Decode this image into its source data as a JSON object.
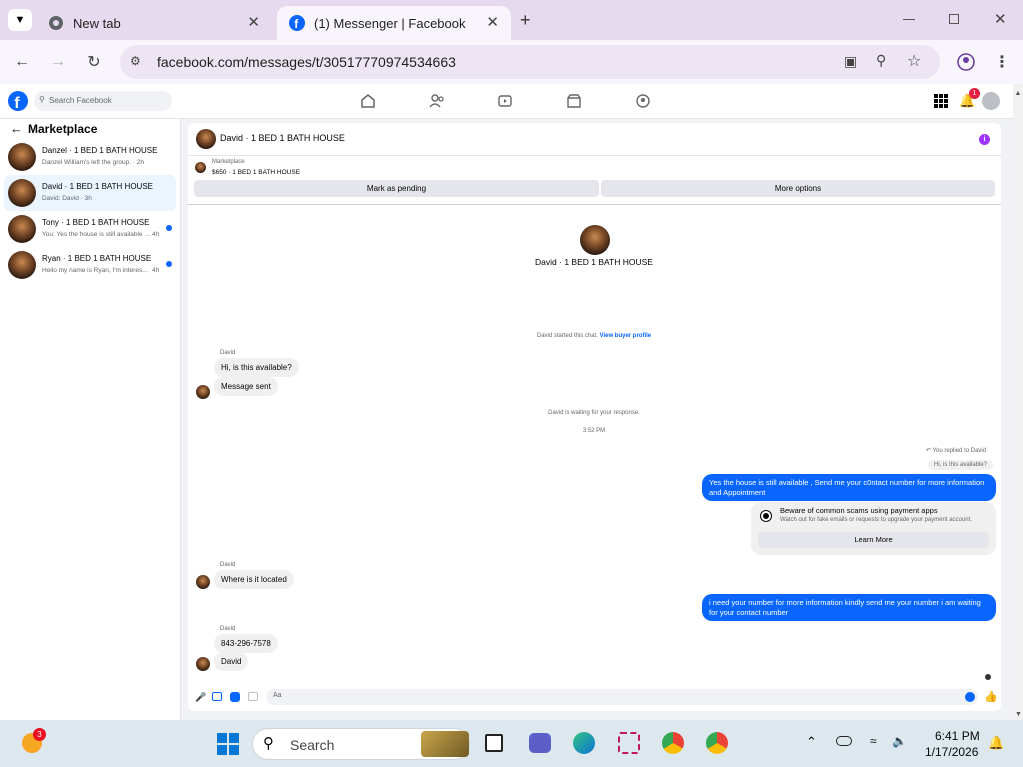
{
  "browser": {
    "tabs": [
      {
        "label": "New tab"
      },
      {
        "label": "(1) Messenger | Facebook"
      }
    ],
    "url": "facebook.com/messages/t/30517770974534663"
  },
  "facebook": {
    "search_placeholder": "Search Facebook",
    "notification_count": "1"
  },
  "sidebar": {
    "title": "Marketplace",
    "conversations": [
      {
        "name": "Danzel · 1 BED 1 BATH HOUSE",
        "preview": "Danzel William's left the group. · 2h",
        "unread": false
      },
      {
        "name": "David · 1 BED 1 BATH HOUSE",
        "preview": "David: David · 3h",
        "unread": false
      },
      {
        "name": "Tony · 1 BED 1 BATH HOUSE",
        "preview": "You: Yes the house is still available ...",
        "time": "4h",
        "unread": true
      },
      {
        "name": "Ryan · 1 BED 1 BATH HOUSE",
        "preview": "Hello my name is Ryan, I'm interes...",
        "time": "4h",
        "unread": true
      }
    ]
  },
  "chat": {
    "header_name": "David · 1 BED 1 BATH HOUSE",
    "listing_label": "Marketplace",
    "listing_detail": "$650 · 1 BED 1 BATH HOUSE",
    "mark_pending": "Mark as pending",
    "more_options": "More options",
    "profile_name": "David · 1 BED 1 BATH HOUSE",
    "started_text": "David started this chat.",
    "view_profile": "View buyer profile",
    "sender_name": "David",
    "msg1": "Hi, is this available?",
    "msg2": "Message sent",
    "waiting_text": "David is waiting for your response.",
    "timestamp": "3:52 PM",
    "replied_to": "You replied to David",
    "quoted": "Hi, is this available?",
    "out1": "Yes the house is still available , Send me your c0ntact number for more information and Appointment",
    "scam_title": "Beware of common scams using payment apps",
    "scam_body": "Watch out for fake emails or requests to upgrade your payment account.",
    "learn_more": "Learn More",
    "msg3": "Where is it located",
    "out2": "i need your number for more information kindly send me your number i am waiting for your contact number",
    "msg4": "843-296-7578",
    "msg5": "David",
    "composer_placeholder": "Aa"
  },
  "taskbar": {
    "search_label": "Search",
    "weather_badge": "3",
    "time": "6:41 PM",
    "date": "1/17/2026"
  },
  "colors": {
    "accent": "#0866ff",
    "fb_blue": "#0866ff"
  }
}
